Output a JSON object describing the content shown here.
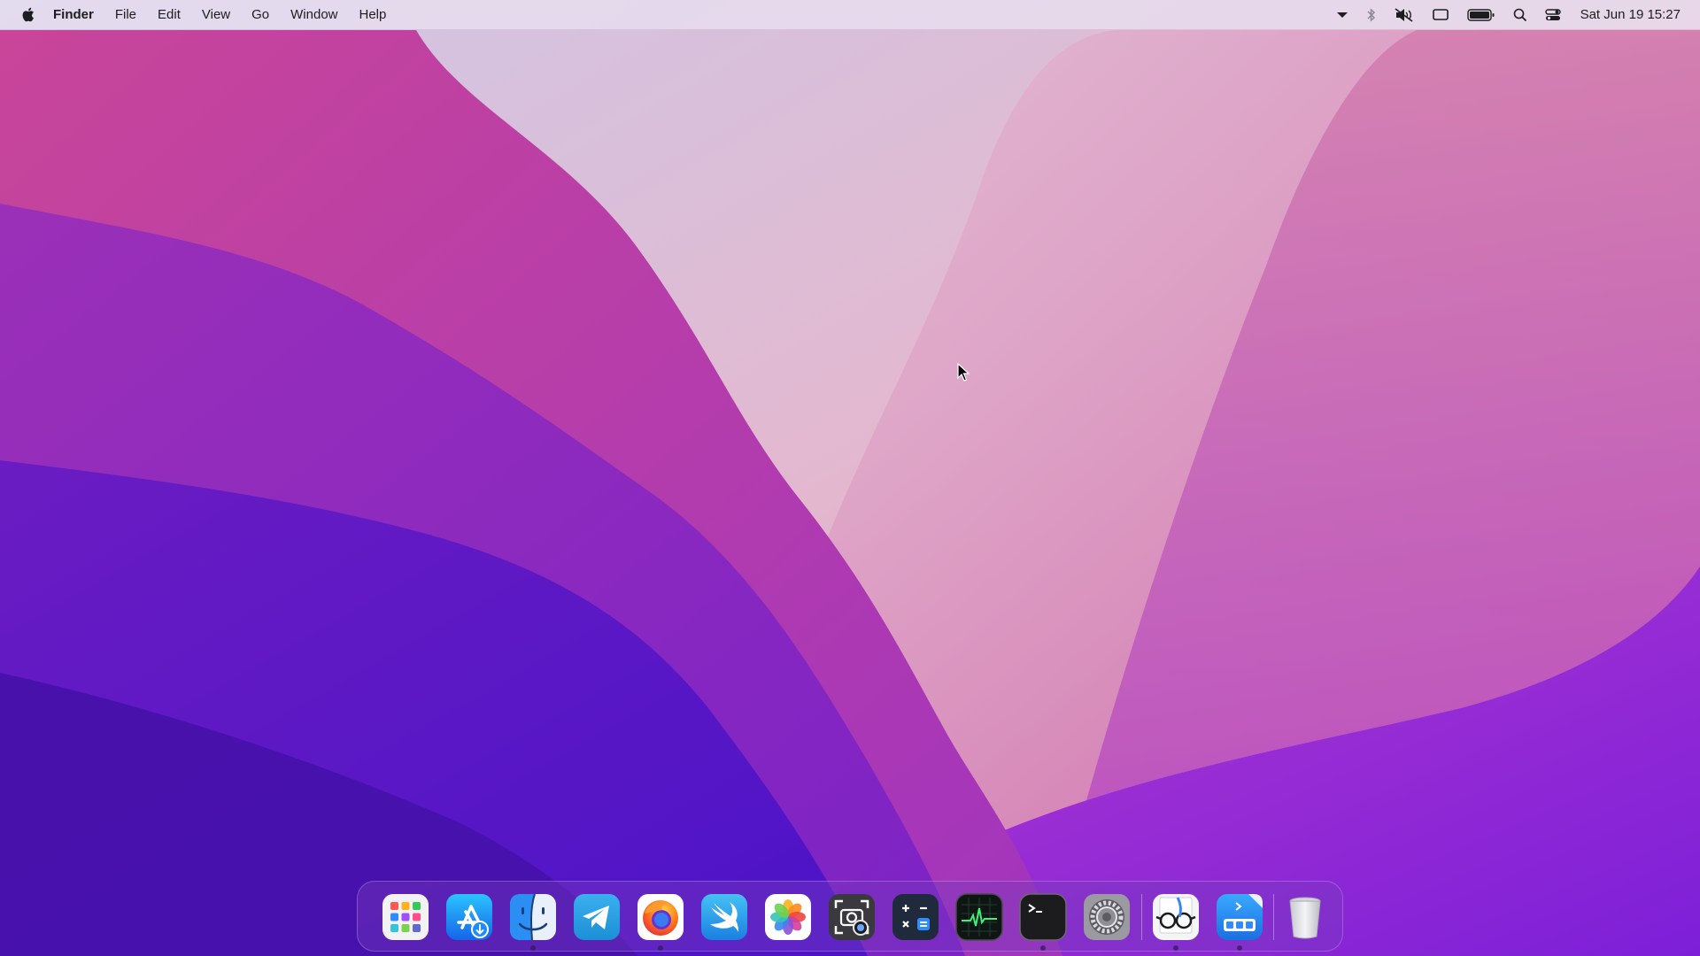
{
  "menubar": {
    "apple_icon": "apple-logo-icon",
    "app_name": "Finder",
    "menus": [
      "File",
      "Edit",
      "View",
      "Go",
      "Window",
      "Help"
    ],
    "status_icons": [
      "chevron-down-icon",
      "bluetooth-icon",
      "sound-muted-icon",
      "screen-mirroring-icon",
      "battery-icon",
      "search-icon",
      "control-center-icon"
    ],
    "clock": "Sat Jun 19  15:27"
  },
  "dock": {
    "apps": [
      {
        "name": "Launchpad",
        "icon": "launchpad-icon",
        "running": false
      },
      {
        "name": "App Store",
        "icon": "app-store-icon",
        "running": false
      },
      {
        "name": "Finder",
        "icon": "finder-icon",
        "running": true
      },
      {
        "name": "Telegram",
        "icon": "telegram-icon",
        "running": false
      },
      {
        "name": "Firefox",
        "icon": "firefox-icon",
        "running": true
      },
      {
        "name": "Swift Playgrounds",
        "icon": "swift-icon",
        "running": false
      },
      {
        "name": "Photos",
        "icon": "photos-icon",
        "running": false
      },
      {
        "name": "Screenshot",
        "icon": "screenshot-icon",
        "running": false
      },
      {
        "name": "Calculator",
        "icon": "calculator-icon",
        "running": false
      },
      {
        "name": "Activity Monitor",
        "icon": "activity-monitor-icon",
        "running": false
      },
      {
        "name": "Terminal",
        "icon": "terminal-icon",
        "running": true
      },
      {
        "name": "System Preferences",
        "icon": "system-preferences-icon",
        "running": false
      },
      {
        "name": "Preview",
        "icon": "preview-icon",
        "running": true
      },
      {
        "name": "Xcode Tool",
        "icon": "developer-tool-icon",
        "running": true
      },
      {
        "name": "Trash",
        "icon": "trash-icon",
        "running": false
      }
    ]
  },
  "colors": {
    "menubar_bg": "#e8e0f0",
    "accent_blue": "#1a8cff",
    "wallpaper_pink": "#d24fa0",
    "wallpaper_purple": "#5d18c9"
  }
}
